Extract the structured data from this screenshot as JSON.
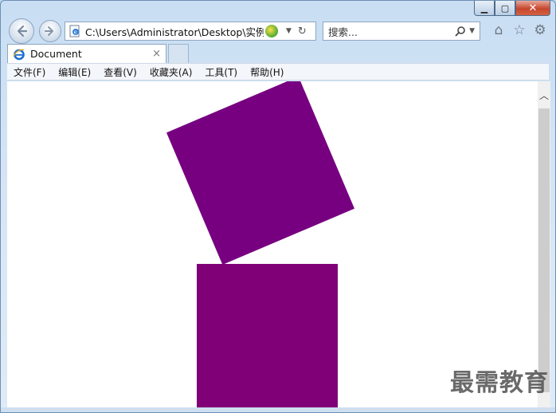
{
  "window": {
    "controls": {
      "minimize": "▁",
      "maximize": "▢",
      "close": "✕"
    }
  },
  "nav": {
    "back_icon": "arrow-left-icon",
    "forward_icon": "arrow-right-icon",
    "address": "C:\\Users\\Administrator\\Desktop\\实例文",
    "search_placeholder": "搜索..."
  },
  "tab": {
    "label": "Document",
    "close": "×"
  },
  "menu": {
    "items": [
      "文件(F)",
      "编辑(E)",
      "查看(V)",
      "收藏夹(A)",
      "工具(T)",
      "帮助(H)"
    ]
  },
  "content": {
    "rotated_box_color": "#770080",
    "bottom_box_color": "#800077"
  },
  "watermark": "最需教育",
  "colors": {
    "frame": "#c9def3",
    "ie_blue": "#1c6fd1"
  }
}
